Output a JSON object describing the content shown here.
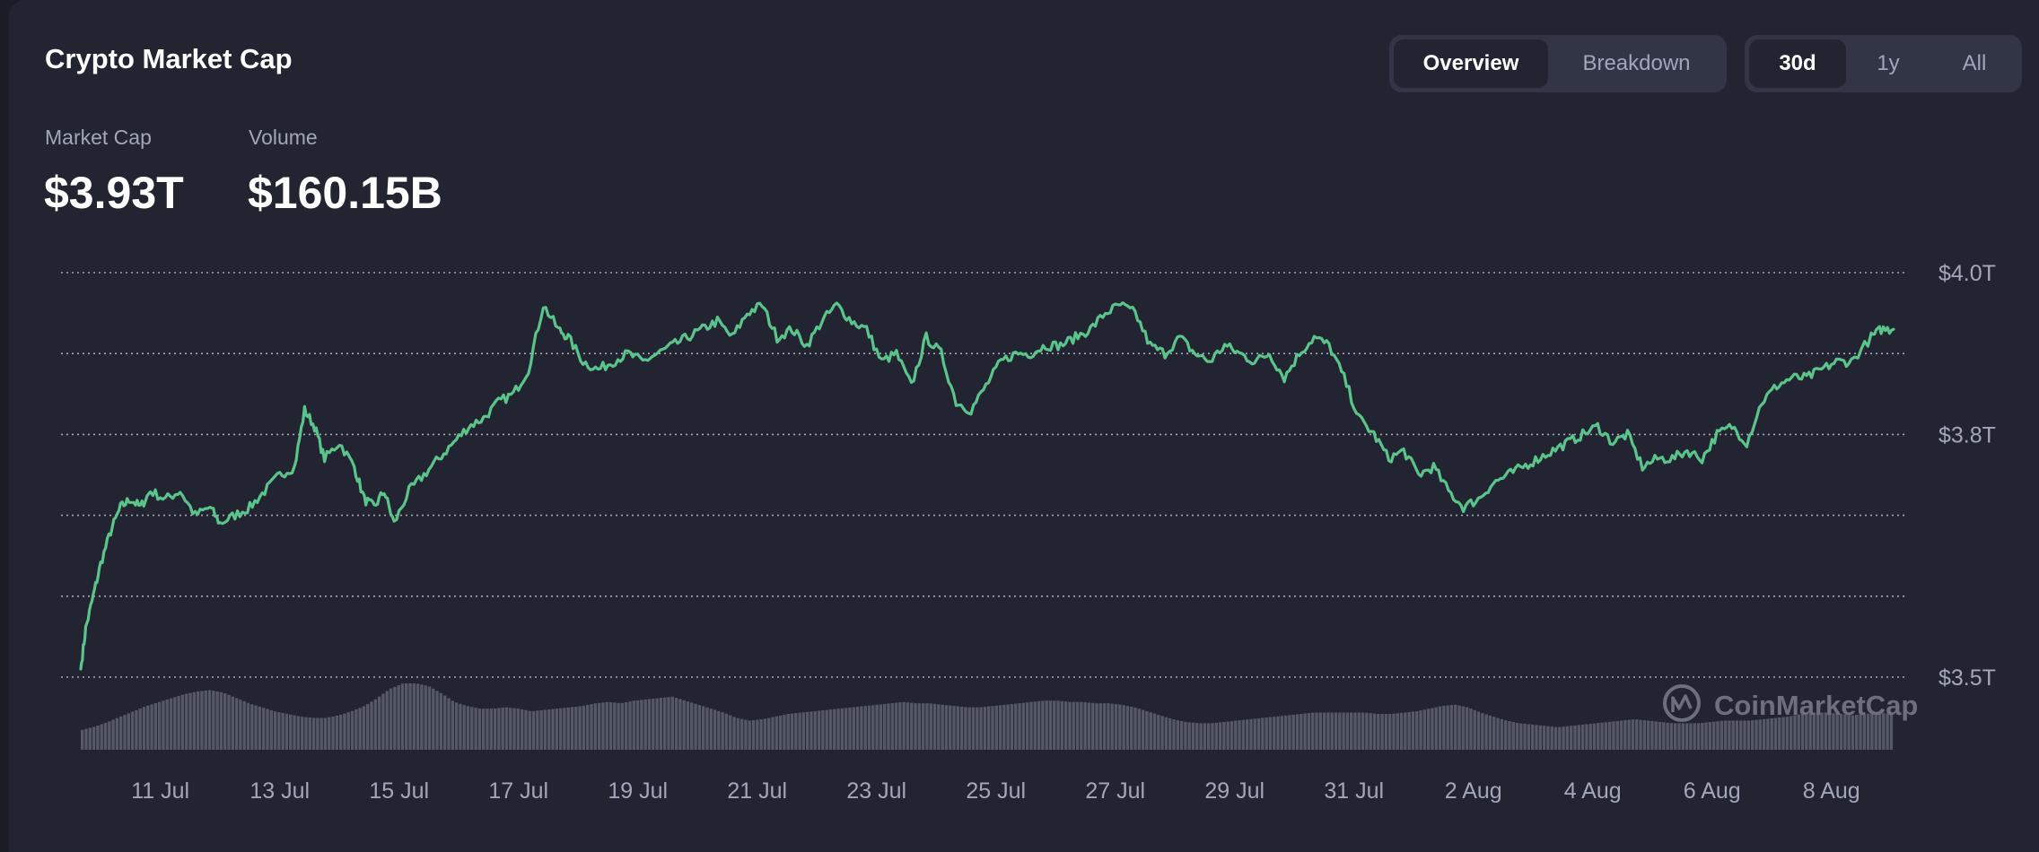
{
  "header": {
    "title": "Crypto Market Cap",
    "view_tabs": [
      {
        "label": "Overview",
        "active": true
      },
      {
        "label": "Breakdown",
        "active": false
      }
    ],
    "range_tabs": [
      {
        "label": "30d",
        "active": true
      },
      {
        "label": "1y",
        "active": false
      },
      {
        "label": "All",
        "active": false
      }
    ]
  },
  "stats": {
    "market_cap_label": "Market Cap",
    "market_cap_value": "$3.93T",
    "volume_label": "Volume",
    "volume_value": "$160.15B"
  },
  "watermark": "CoinMarketCap",
  "colors": {
    "background": "#222531",
    "line": "#5ac48b",
    "volume_bars": "#5a5e6e",
    "grid": "#c8ccd6",
    "axis_text": "#a1a7bb",
    "tab_active": "#222531",
    "tab_group": "#323546"
  },
  "chart_data": {
    "type": "line",
    "x_ticks": [
      "11 Jul",
      "13 Jul",
      "15 Jul",
      "17 Jul",
      "19 Jul",
      "21 Jul",
      "23 Jul",
      "25 Jul",
      "27 Jul",
      "29 Jul",
      "31 Jul",
      "2 Aug",
      "4 Aug",
      "6 Aug",
      "8 Aug"
    ],
    "y_ticks": [
      {
        "value": 4.0,
        "label": "$4.0T"
      },
      {
        "value": 3.8,
        "label": "$3.8T"
      },
      {
        "value": 3.5,
        "label": "$3.5T"
      }
    ],
    "y_gridlines": [
      3.5,
      3.6,
      3.7,
      3.8,
      3.9,
      4.0
    ],
    "ylim": [
      3.5,
      4.0
    ],
    "x_start": "2025-07-09T16:00",
    "x_end": "2025-08-09T01:00",
    "series": [
      {
        "values": [
          [
            "2025-07-09T16:00",
            3.51
          ],
          [
            "2025-07-09T18:00",
            3.56
          ],
          [
            "2025-07-09T21:00",
            3.6
          ],
          [
            "2025-07-10T00:00",
            3.64
          ],
          [
            "2025-07-10T04:00",
            3.68
          ],
          [
            "2025-07-10T08:00",
            3.71
          ],
          [
            "2025-07-10T12:00",
            3.72
          ],
          [
            "2025-07-10T16:00",
            3.71
          ],
          [
            "2025-07-10T20:00",
            3.73
          ],
          [
            "2025-07-11T02:00",
            3.72
          ],
          [
            "2025-07-11T08:00",
            3.73
          ],
          [
            "2025-07-11T14:00",
            3.7
          ],
          [
            "2025-07-11T20:00",
            3.71
          ],
          [
            "2025-07-12T00:00",
            3.69
          ],
          [
            "2025-07-12T06:00",
            3.7
          ],
          [
            "2025-07-12T12:00",
            3.71
          ],
          [
            "2025-07-12T18:00",
            3.73
          ],
          [
            "2025-07-13T00:00",
            3.75
          ],
          [
            "2025-07-13T06:00",
            3.76
          ],
          [
            "2025-07-13T10:00",
            3.83
          ],
          [
            "2025-07-13T14:00",
            3.81
          ],
          [
            "2025-07-13T18:00",
            3.77
          ],
          [
            "2025-07-14T00:00",
            3.79
          ],
          [
            "2025-07-14T06:00",
            3.76
          ],
          [
            "2025-07-14T10:00",
            3.72
          ],
          [
            "2025-07-14T14:00",
            3.71
          ],
          [
            "2025-07-14T18:00",
            3.73
          ],
          [
            "2025-07-14T22:00",
            3.69
          ],
          [
            "2025-07-15T04:00",
            3.73
          ],
          [
            "2025-07-15T10:00",
            3.75
          ],
          [
            "2025-07-15T16:00",
            3.77
          ],
          [
            "2025-07-15T22:00",
            3.79
          ],
          [
            "2025-07-16T04:00",
            3.81
          ],
          [
            "2025-07-16T10:00",
            3.82
          ],
          [
            "2025-07-16T16:00",
            3.84
          ],
          [
            "2025-07-16T22:00",
            3.85
          ],
          [
            "2025-07-17T04:00",
            3.88
          ],
          [
            "2025-07-17T10:00",
            3.96
          ],
          [
            "2025-07-17T16:00",
            3.93
          ],
          [
            "2025-07-17T20:00",
            3.92
          ],
          [
            "2025-07-18T02:00",
            3.89
          ],
          [
            "2025-07-18T08:00",
            3.88
          ],
          [
            "2025-07-18T14:00",
            3.89
          ],
          [
            "2025-07-18T20:00",
            3.9
          ],
          [
            "2025-07-19T02:00",
            3.89
          ],
          [
            "2025-07-19T08:00",
            3.9
          ],
          [
            "2025-07-19T14:00",
            3.91
          ],
          [
            "2025-07-19T20:00",
            3.92
          ],
          [
            "2025-07-20T02:00",
            3.93
          ],
          [
            "2025-07-20T08:00",
            3.94
          ],
          [
            "2025-07-20T14:00",
            3.92
          ],
          [
            "2025-07-20T20:00",
            3.95
          ],
          [
            "2025-07-21T02:00",
            3.96
          ],
          [
            "2025-07-21T08:00",
            3.92
          ],
          [
            "2025-07-21T14:00",
            3.93
          ],
          [
            "2025-07-21T20:00",
            3.91
          ],
          [
            "2025-07-22T02:00",
            3.94
          ],
          [
            "2025-07-22T08:00",
            3.96
          ],
          [
            "2025-07-22T14:00",
            3.94
          ],
          [
            "2025-07-22T20:00",
            3.93
          ],
          [
            "2025-07-23T02:00",
            3.89
          ],
          [
            "2025-07-23T08:00",
            3.9
          ],
          [
            "2025-07-23T14:00",
            3.86
          ],
          [
            "2025-07-23T20:00",
            3.92
          ],
          [
            "2025-07-24T02:00",
            3.9
          ],
          [
            "2025-07-24T08:00",
            3.84
          ],
          [
            "2025-07-24T14:00",
            3.83
          ],
          [
            "2025-07-24T20:00",
            3.86
          ],
          [
            "2025-07-25T02:00",
            3.89
          ],
          [
            "2025-07-25T08:00",
            3.9
          ],
          [
            "2025-07-25T14:00",
            3.9
          ],
          [
            "2025-07-25T20:00",
            3.91
          ],
          [
            "2025-07-26T02:00",
            3.91
          ],
          [
            "2025-07-26T08:00",
            3.92
          ],
          [
            "2025-07-26T14:00",
            3.93
          ],
          [
            "2025-07-26T20:00",
            3.95
          ],
          [
            "2025-07-27T02:00",
            3.96
          ],
          [
            "2025-07-27T08:00",
            3.95
          ],
          [
            "2025-07-27T14:00",
            3.91
          ],
          [
            "2025-07-27T20:00",
            3.9
          ],
          [
            "2025-07-28T02:00",
            3.92
          ],
          [
            "2025-07-28T08:00",
            3.9
          ],
          [
            "2025-07-28T14:00",
            3.89
          ],
          [
            "2025-07-28T20:00",
            3.91
          ],
          [
            "2025-07-29T02:00",
            3.9
          ],
          [
            "2025-07-29T08:00",
            3.89
          ],
          [
            "2025-07-29T14:00",
            3.9
          ],
          [
            "2025-07-29T20:00",
            3.87
          ],
          [
            "2025-07-30T02:00",
            3.9
          ],
          [
            "2025-07-30T08:00",
            3.92
          ],
          [
            "2025-07-30T14:00",
            3.91
          ],
          [
            "2025-07-30T20:00",
            3.87
          ],
          [
            "2025-07-31T02:00",
            3.82
          ],
          [
            "2025-07-31T08:00",
            3.8
          ],
          [
            "2025-07-31T14:00",
            3.77
          ],
          [
            "2025-07-31T20:00",
            3.78
          ],
          [
            "2025-08-01T02:00",
            3.75
          ],
          [
            "2025-08-01T08:00",
            3.76
          ],
          [
            "2025-08-01T14:00",
            3.73
          ],
          [
            "2025-08-01T20:00",
            3.71
          ],
          [
            "2025-08-02T02:00",
            3.72
          ],
          [
            "2025-08-02T08:00",
            3.74
          ],
          [
            "2025-08-02T14:00",
            3.75
          ],
          [
            "2025-08-02T20:00",
            3.76
          ],
          [
            "2025-08-03T02:00",
            3.77
          ],
          [
            "2025-08-03T08:00",
            3.78
          ],
          [
            "2025-08-03T14:00",
            3.79
          ],
          [
            "2025-08-03T20:00",
            3.8
          ],
          [
            "2025-08-04T02:00",
            3.81
          ],
          [
            "2025-08-04T08:00",
            3.79
          ],
          [
            "2025-08-04T14:00",
            3.8
          ],
          [
            "2025-08-04T20:00",
            3.76
          ],
          [
            "2025-08-05T02:00",
            3.77
          ],
          [
            "2025-08-05T08:00",
            3.77
          ],
          [
            "2025-08-05T14:00",
            3.78
          ],
          [
            "2025-08-05T20:00",
            3.77
          ],
          [
            "2025-08-06T02:00",
            3.8
          ],
          [
            "2025-08-06T08:00",
            3.81
          ],
          [
            "2025-08-06T14:00",
            3.79
          ],
          [
            "2025-08-06T20:00",
            3.84
          ],
          [
            "2025-08-07T02:00",
            3.86
          ],
          [
            "2025-08-07T08:00",
            3.87
          ],
          [
            "2025-08-07T14:00",
            3.87
          ],
          [
            "2025-08-07T20:00",
            3.88
          ],
          [
            "2025-08-08T02:00",
            3.89
          ],
          [
            "2025-08-08T08:00",
            3.89
          ],
          [
            "2025-08-08T16:00",
            3.92
          ],
          [
            "2025-08-08T20:00",
            3.93
          ],
          [
            "2025-08-09T01:00",
            3.93
          ]
        ]
      }
    ],
    "volume_relative": [
      0.3,
      0.35,
      0.42,
      0.5,
      0.58,
      0.66,
      0.72,
      0.78,
      0.84,
      0.88,
      0.9,
      0.86,
      0.78,
      0.7,
      0.64,
      0.58,
      0.54,
      0.5,
      0.48,
      0.48,
      0.52,
      0.58,
      0.66,
      0.78,
      0.92,
      1.0,
      1.0,
      0.96,
      0.85,
      0.72,
      0.66,
      0.62,
      0.62,
      0.64,
      0.62,
      0.58,
      0.6,
      0.62,
      0.64,
      0.66,
      0.7,
      0.72,
      0.7,
      0.74,
      0.76,
      0.78,
      0.8,
      0.74,
      0.68,
      0.62,
      0.56,
      0.48,
      0.44,
      0.46,
      0.5,
      0.54,
      0.56,
      0.58,
      0.6,
      0.62,
      0.64,
      0.66,
      0.68,
      0.7,
      0.72,
      0.7,
      0.7,
      0.68,
      0.66,
      0.64,
      0.64,
      0.66,
      0.68,
      0.7,
      0.72,
      0.74,
      0.74,
      0.72,
      0.72,
      0.7,
      0.7,
      0.68,
      0.64,
      0.58,
      0.52,
      0.46,
      0.42,
      0.4,
      0.4,
      0.42,
      0.44,
      0.46,
      0.48,
      0.5,
      0.52,
      0.54,
      0.56,
      0.56,
      0.56,
      0.56,
      0.56,
      0.54,
      0.54,
      0.56,
      0.58,
      0.62,
      0.66,
      0.68,
      0.64,
      0.56,
      0.5,
      0.44,
      0.4,
      0.38,
      0.36,
      0.34,
      0.36,
      0.38,
      0.4,
      0.42,
      0.44,
      0.46,
      0.44,
      0.42,
      0.4,
      0.4,
      0.4,
      0.42,
      0.44,
      0.44,
      0.44,
      0.46,
      0.48,
      0.5,
      0.54,
      0.56,
      0.56,
      0.54,
      0.52,
      0.54,
      0.56,
      0.54
    ]
  }
}
